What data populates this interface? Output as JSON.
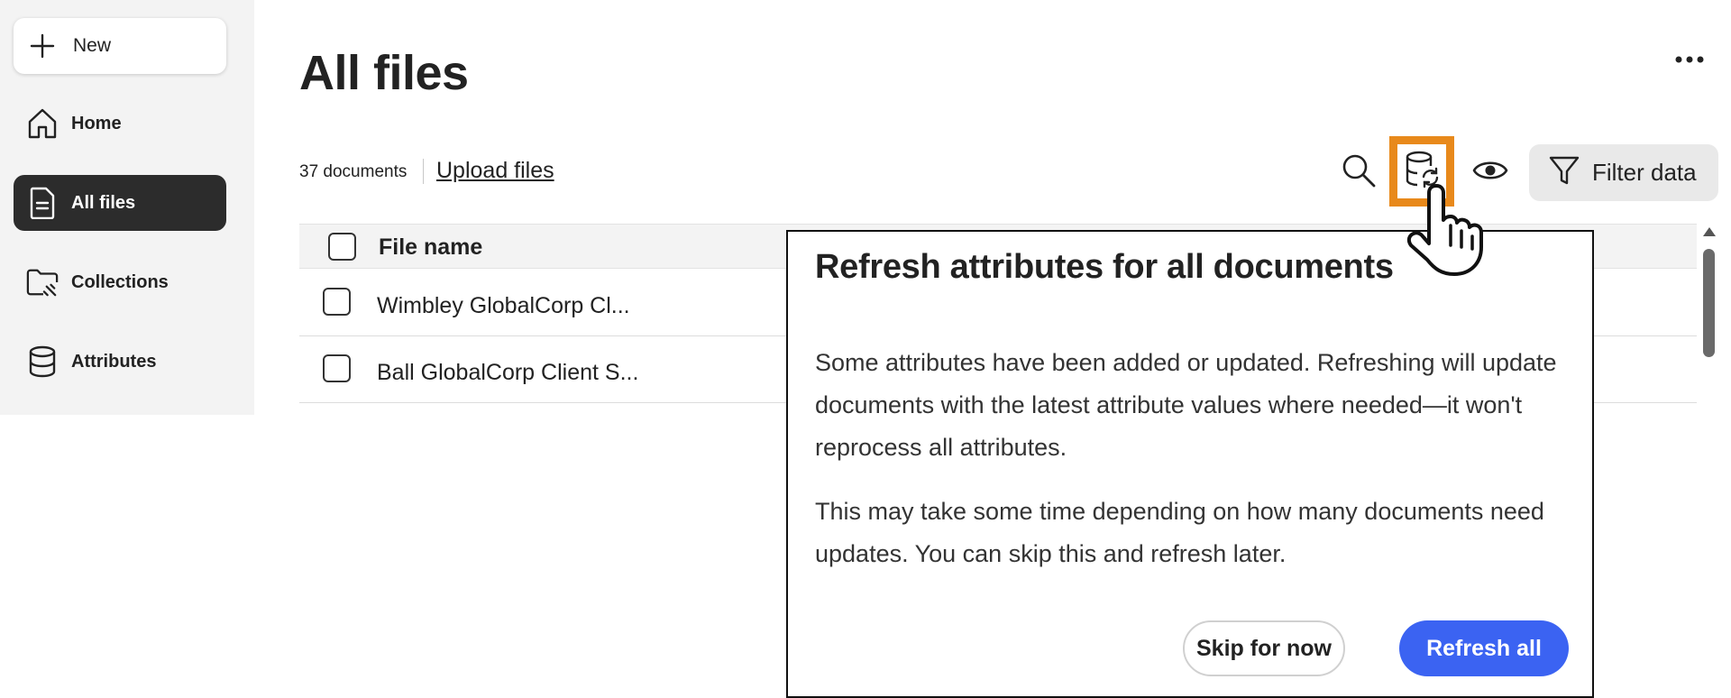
{
  "sidebar": {
    "new_label": "New",
    "items": [
      {
        "label": "Home",
        "icon": "home-icon"
      },
      {
        "label": "All files",
        "icon": "document-icon",
        "active": true
      },
      {
        "label": "Collections",
        "icon": "folder-icon"
      },
      {
        "label": "Attributes",
        "icon": "database-icon"
      }
    ]
  },
  "main": {
    "title": "All files",
    "doc_count": "37 documents",
    "upload_label": "Upload files",
    "toolbar": {
      "icons": [
        "search-icon",
        "refresh-attributes-icon",
        "eye-icon"
      ],
      "filter_label": "Filter data",
      "highlight_color": "#e8891b"
    },
    "table": {
      "column": "File name",
      "rows": [
        {
          "name": "Wimbley GlobalCorp Cl..."
        },
        {
          "name": "Ball GlobalCorp Client S..."
        }
      ]
    }
  },
  "popover": {
    "title": "Refresh attributes for all documents",
    "paragraph1": "Some attributes have been added or updated. Refreshing will update documents with the latest attribute values where needed—it won't reprocess all attributes.",
    "paragraph2": "This may take some time depending on how many documents need updates. You can skip this and refresh later.",
    "skip_label": "Skip for now",
    "refresh_label": "Refresh all",
    "accent_color": "#3b63f2"
  }
}
